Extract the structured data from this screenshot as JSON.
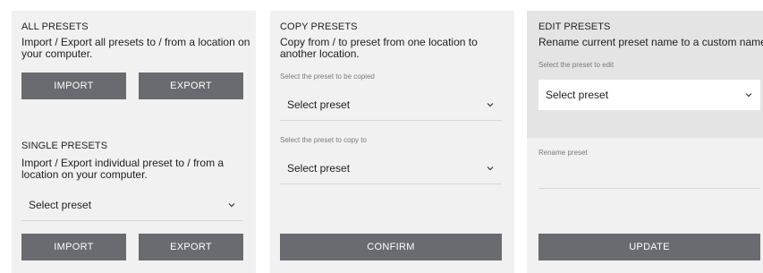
{
  "all_presets": {
    "title": "ALL PRESETS",
    "description": "Import / Export all presets to / from a location on your computer.",
    "import_label": "IMPORT",
    "export_label": "EXPORT"
  },
  "single_presets": {
    "title": "SINGLE PRESETS",
    "description": "Import / Export individual preset to / from a location on your computer.",
    "select_value": "Select preset",
    "import_label": "IMPORT",
    "export_label": "EXPORT"
  },
  "copy_presets": {
    "title": "COPY PRESETS",
    "description": "Copy from / to preset from one location to another location.",
    "from_hint": "Select the preset to be copied",
    "from_value": "Select preset",
    "to_hint": "Select the preset to copy to",
    "to_value": "Select preset",
    "confirm_label": "CONFIRM"
  },
  "edit_presets": {
    "title": "EDIT PRESETS",
    "description": "Rename current preset name to a custom name.",
    "select_hint": "Select the preset to edit",
    "select_value": "Select preset",
    "rename_hint": "Rename preset",
    "rename_value": "",
    "update_label": "UPDATE"
  },
  "icons": {
    "dropdown": "chevron-down-icon"
  },
  "colors": {
    "panel_bg": "#f1f1f1",
    "button_bg": "#6a6b70",
    "edit_header_bg": "#e4e4e4"
  }
}
